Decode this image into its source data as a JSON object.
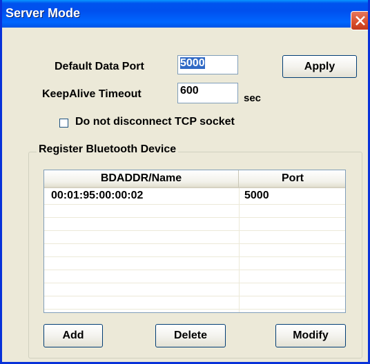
{
  "window": {
    "title": "Server Mode"
  },
  "settings": {
    "default_port_label": "Default Data Port",
    "default_port_value": "5000",
    "keepalive_label": "KeepAlive Timeout",
    "keepalive_value": "600",
    "keepalive_unit": "sec",
    "apply_label": "Apply",
    "disconnect_checkbox_label": "Do not disconnect TCP socket",
    "disconnect_checked": false
  },
  "register": {
    "group_label": "Register Bluetooth Device",
    "columns": [
      "BDADDR/Name",
      "Port"
    ],
    "rows": [
      {
        "bdaddr": "00:01:95:00:00:02",
        "port": "5000"
      }
    ],
    "add_label": "Add",
    "delete_label": "Delete",
    "modify_label": "Modify"
  },
  "colors": {
    "titlebar": "#0053ee",
    "dialog_bg": "#ece9d8",
    "selection": "#316ac5",
    "close_button": "#d94f2c"
  },
  "icons": {
    "close": "close-icon"
  }
}
